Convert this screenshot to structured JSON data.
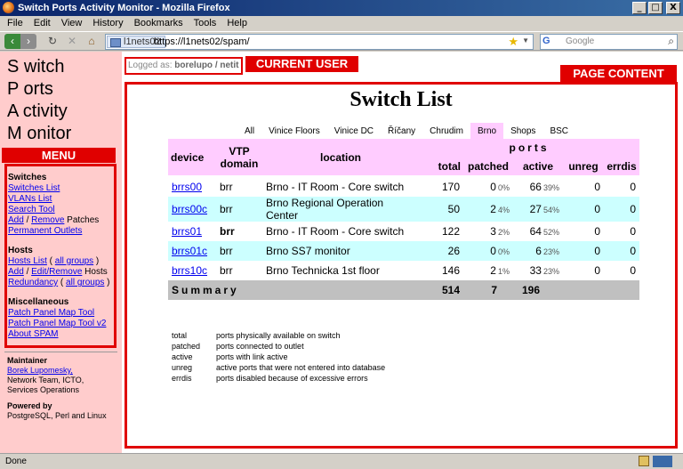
{
  "window": {
    "title": "Switch Ports Activity Monitor - Mozilla Firefox",
    "controls": [
      "_",
      "□",
      "X"
    ]
  },
  "menubar": [
    "File",
    "Edit",
    "View",
    "History",
    "Bookmarks",
    "Tools",
    "Help"
  ],
  "navbar": {
    "back": "‹",
    "forward": "›",
    "reload": "↻",
    "stop": "✕",
    "home": "⌂",
    "site_badge": "l1nets02",
    "url": "https://l1nets02/spam/",
    "search_engine": "G",
    "search_placeholder": "Google"
  },
  "sidebar": {
    "logo": [
      "S witch",
      "P orts",
      "A ctivity",
      "M onitor"
    ],
    "menu_tag": "MENU",
    "switches": {
      "head": "Switches",
      "switches_list": "Switches List",
      "vlans_list": "VLANs List",
      "search_tool": "Search Tool",
      "add": "Add",
      "slash": " / ",
      "remove": "Remove",
      "patches": " Patches",
      "permanent_outlets": "Permanent Outlets"
    },
    "hosts": {
      "head": "Hosts",
      "hosts_list": "Hosts List",
      "all_groups": "all groups",
      "add": "Add",
      "edit_remove": "Edit/Remove",
      "hosts_word": " Hosts",
      "redundancy": "Redundancy",
      "all_groups2": "all groups",
      "paren_open": " ( ",
      "paren_close": " )"
    },
    "misc": {
      "head": "Miscellaneous",
      "patch_panel": "Patch Panel Map Tool",
      "patch_panel_v2": "Patch Panel Map Tool v2",
      "about": "About SPAM"
    },
    "maintainer": {
      "head": "Maintainer",
      "name": "Borek Lupomesky,",
      "team": "Network Team, ICTO,",
      "ops": "Services Operations",
      "powered_head": "Powered by",
      "powered": "PostgreSQL, Perl and Linux"
    }
  },
  "logged": {
    "label": "Logged as: ",
    "user": "borelupo / netit",
    "tag": "CURRENT USER"
  },
  "content": {
    "tag": "PAGE CONTENT",
    "title": "Switch List",
    "tabs": [
      "All",
      "Vinice Floors",
      "Vinice DC",
      "Říčany",
      "Chrudim",
      "Brno",
      "Shops",
      "BSC"
    ],
    "active_tab": "Brno",
    "headers": {
      "device": "device",
      "vtp": "VTP domain",
      "location": "location",
      "ports": "ports",
      "total": "total",
      "patched": "patched",
      "active": "active",
      "unreg": "unreg",
      "errdis": "errdis"
    },
    "rows": [
      {
        "device": "brrs00",
        "vtp": "brr",
        "location": "Brno - IT Room - Core switch",
        "total": "170",
        "patched": "0",
        "patched_pct": "0%",
        "active": "66",
        "active_pct": "39%",
        "unreg": "0",
        "errdis": "0"
      },
      {
        "device": "brrs00c",
        "vtp": "brr",
        "location": "Brno Regional Operation Center",
        "total": "50",
        "patched": "2",
        "patched_pct": "4%",
        "active": "27",
        "active_pct": "54%",
        "unreg": "0",
        "errdis": "0"
      },
      {
        "device": "brrs01",
        "vtp": "brr",
        "location": "Brno - IT Room - Core switch",
        "total": "122",
        "patched": "3",
        "patched_pct": "2%",
        "active": "64",
        "active_pct": "52%",
        "unreg": "0",
        "errdis": "0"
      },
      {
        "device": "brrs01c",
        "vtp": "brr",
        "location": "Brno SS7 monitor",
        "total": "26",
        "patched": "0",
        "patched_pct": "0%",
        "active": "6",
        "active_pct": "23%",
        "unreg": "0",
        "errdis": "0"
      },
      {
        "device": "brrs10c",
        "vtp": "brr",
        "location": "Brno Technicka 1st floor",
        "total": "146",
        "patched": "2",
        "patched_pct": "1%",
        "active": "33",
        "active_pct": "23%",
        "unreg": "0",
        "errdis": "0"
      }
    ],
    "summary": {
      "label": "Summary",
      "total": "514",
      "patched": "7",
      "active": "196"
    },
    "legend": [
      {
        "k": "total",
        "v": "ports physically available on switch"
      },
      {
        "k": "patched",
        "v": "ports connected to outlet"
      },
      {
        "k": "active",
        "v": "ports with link active"
      },
      {
        "k": "unreg",
        "v": "active ports that were not entered into database"
      },
      {
        "k": "errdis",
        "v": "ports disabled because of excessive errors"
      }
    ]
  },
  "status": {
    "text": "Done"
  }
}
